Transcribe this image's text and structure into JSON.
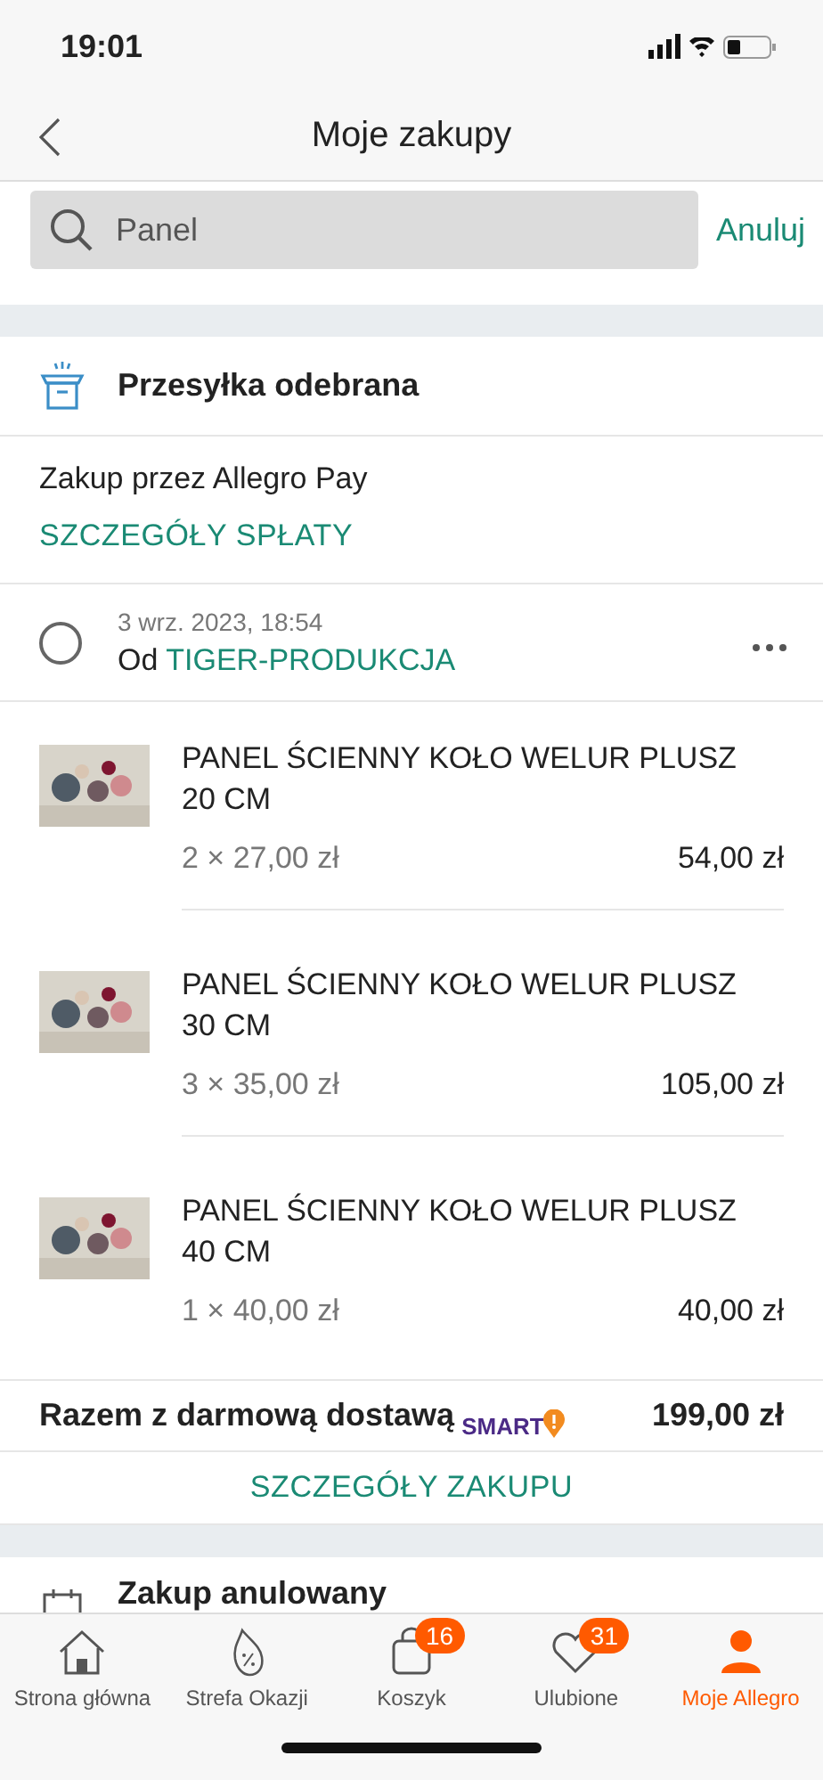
{
  "status_bar": {
    "time": "19:01"
  },
  "nav": {
    "title": "Moje zakupy"
  },
  "search": {
    "value": "Panel",
    "cancel": "Anuluj"
  },
  "order": {
    "status": "Przesyłka odebrana",
    "payment": "Zakup przez Allegro Pay",
    "payment_link": "SZCZEGÓŁY SPŁATY",
    "date": "3 wrz. 2023, 18:54",
    "seller_prefix": "Od",
    "seller": "TIGER-PRODUKCJA",
    "selected": false,
    "items": [
      {
        "name": "PANEL ŚCIENNY KOŁO WELUR PLUSZ 20 CM",
        "qty_price": "2 × 27,00 zł",
        "total": "54,00 zł"
      },
      {
        "name": "PANEL ŚCIENNY KOŁO WELUR PLUSZ 30 CM",
        "qty_price": "3 × 35,00 zł",
        "total": "105,00 zł"
      },
      {
        "name": "PANEL ŚCIENNY KOŁO WELUR PLUSZ 40 CM",
        "qty_price": "1 × 40,00 zł",
        "total": "40,00 zł"
      }
    ],
    "total_label": "Razem z darmową dostawą",
    "smart": "SMART",
    "total": "199,00 zł",
    "details": "SZCZEGÓŁY ZAKUPU"
  },
  "next_order": {
    "status": "Zakup anulowany"
  },
  "tab_bar": [
    {
      "kind": "home",
      "label": "Strona główna",
      "selected": false
    },
    {
      "kind": "deals",
      "label": "Strefa Okazji",
      "selected": false
    },
    {
      "kind": "cart",
      "label": "Koszyk",
      "badge": "16",
      "selected": false
    },
    {
      "kind": "heart",
      "label": "Ulubione",
      "badge": "31",
      "selected": false
    },
    {
      "kind": "user",
      "label": "Moje Allegro",
      "selected": true
    }
  ]
}
